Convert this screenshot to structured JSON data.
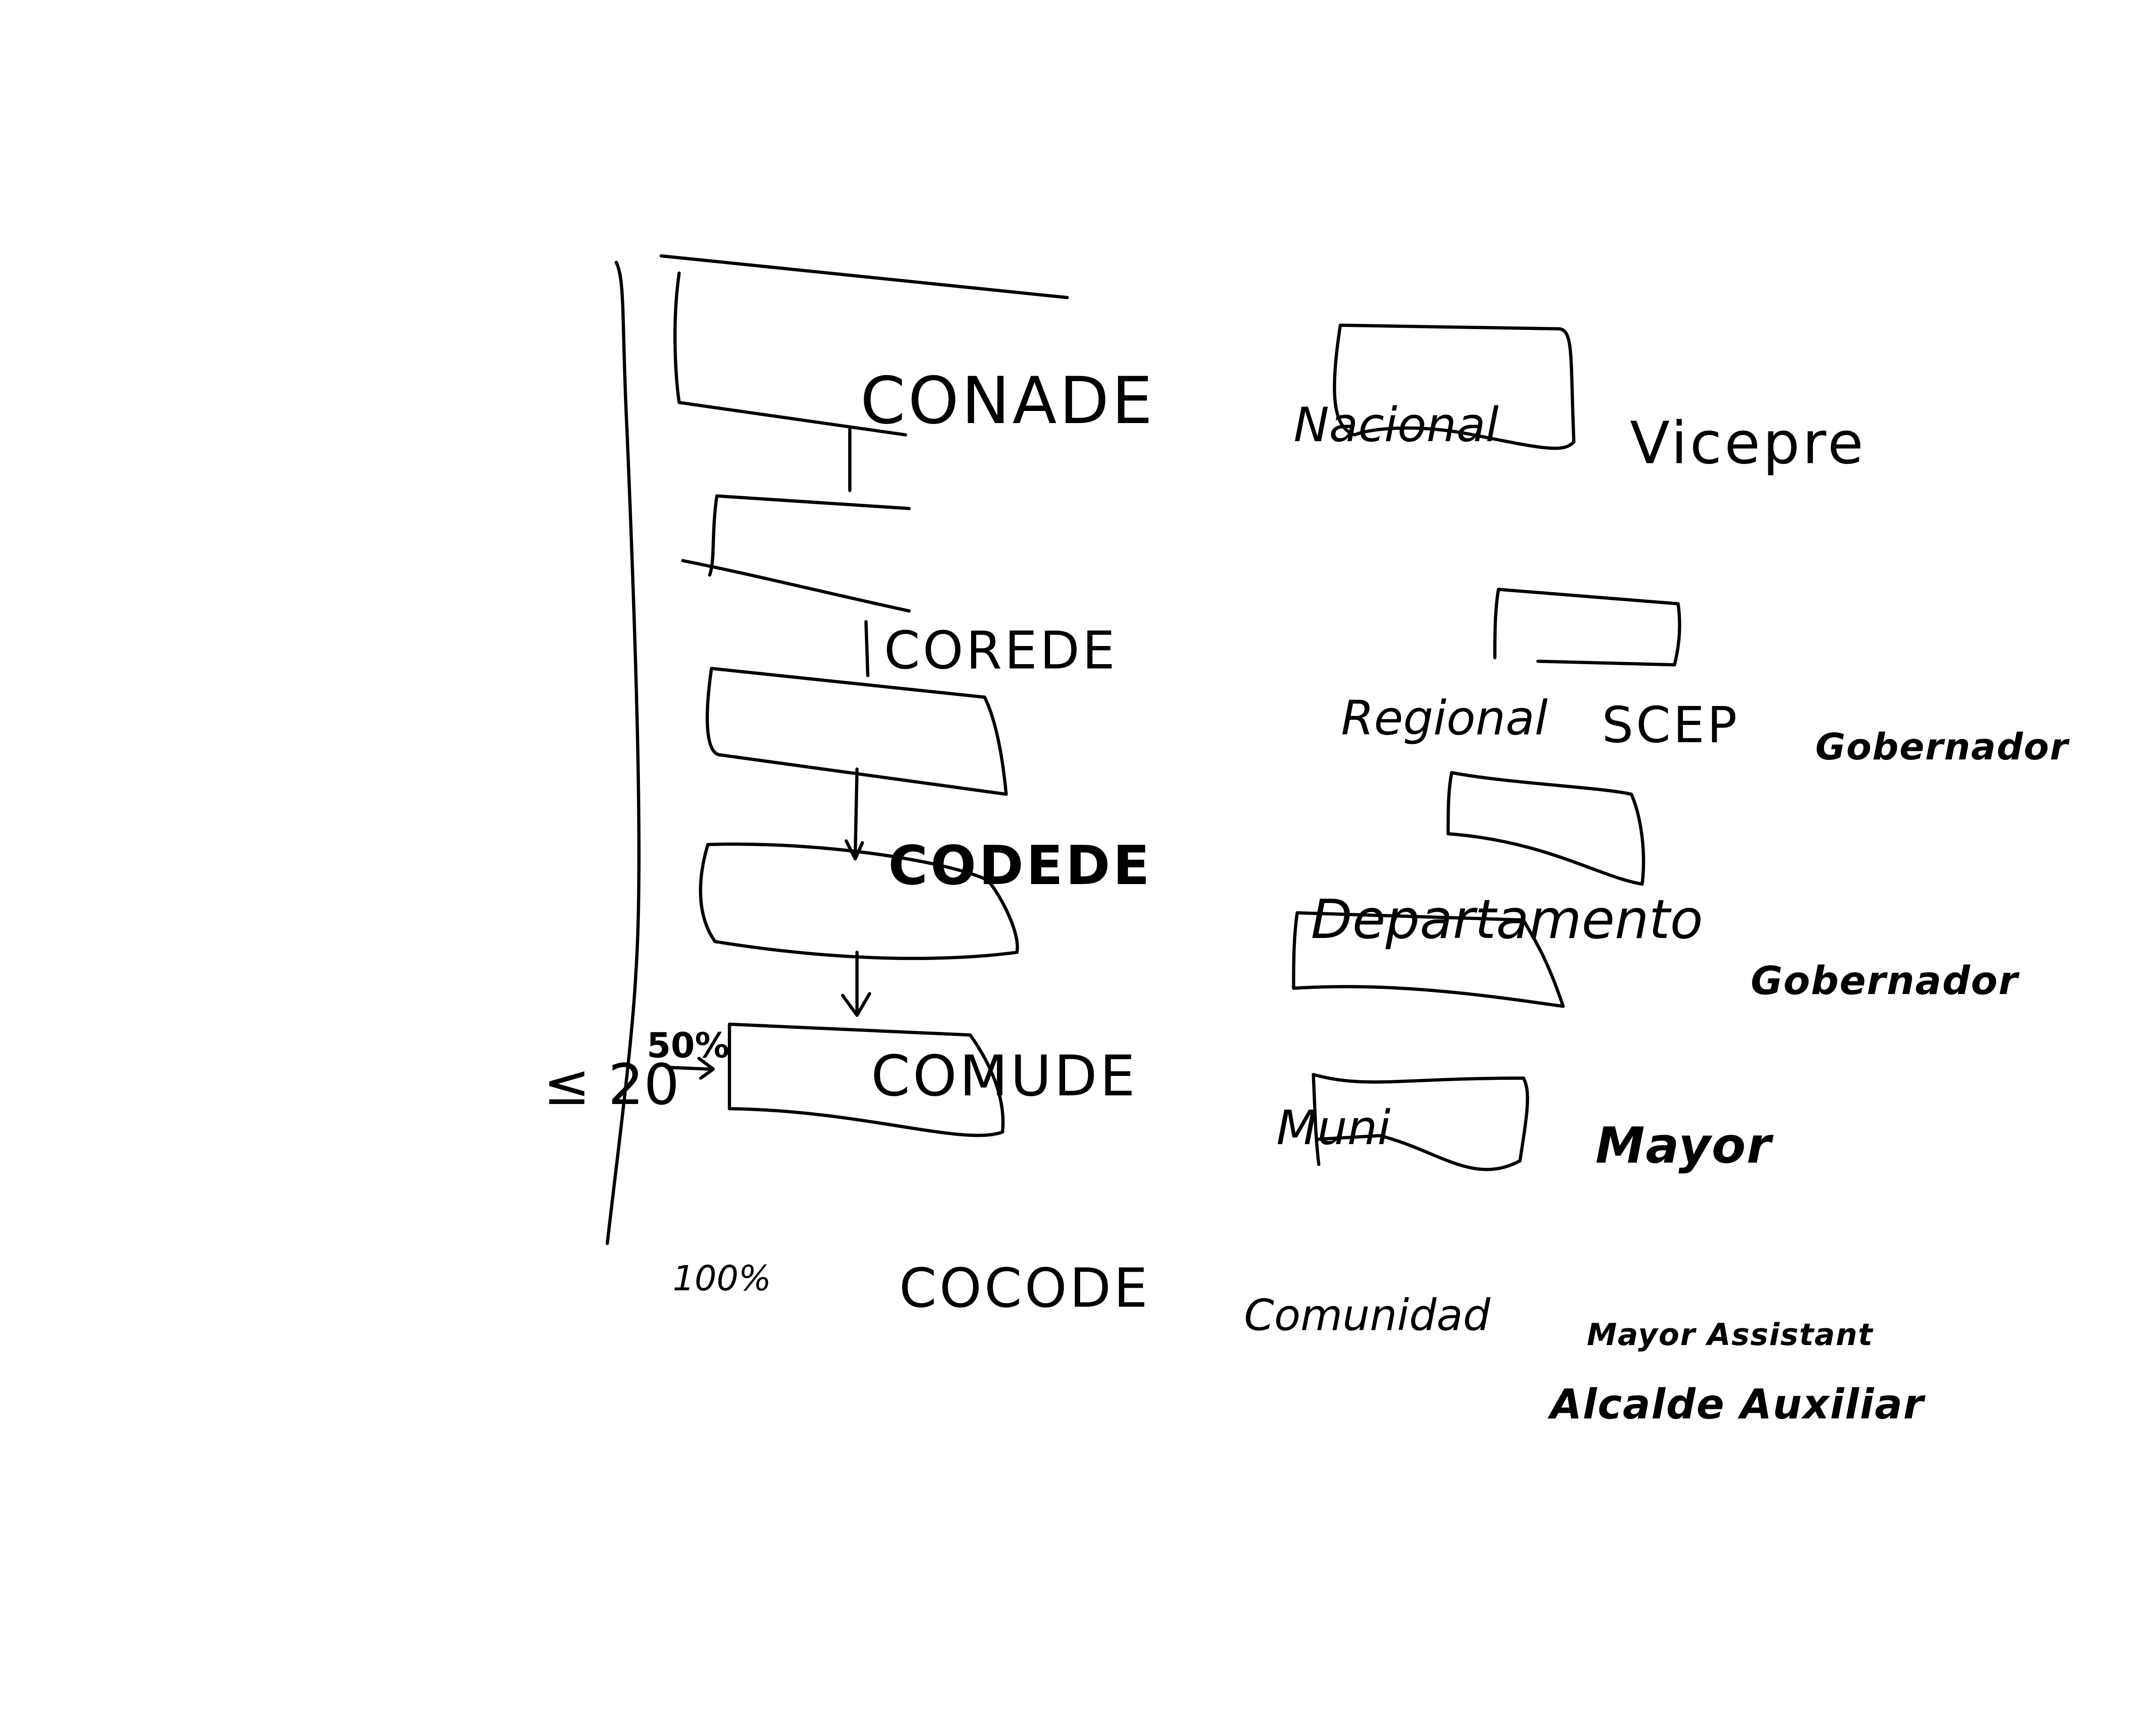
{
  "levels": [
    {
      "council": "CONADE",
      "scope": "Nacional",
      "extra": "",
      "leader": "Vicepre"
    },
    {
      "council": "COREDE",
      "scope": "Regional",
      "extra": "SCEP",
      "leader": "Gobernador"
    },
    {
      "council": "CODEDE",
      "scope": "Departamento",
      "extra": "",
      "leader": "Gobernador"
    },
    {
      "council": "COMUDE",
      "scope": "Muni",
      "extra": "",
      "leader": "Mayor"
    },
    {
      "council": "COCODE",
      "scope": "Comunidad",
      "extra": "",
      "leader": "Mayor Assistant",
      "leader_alt": "Alcalde Auxiliar"
    }
  ],
  "annotations": {
    "limit": "≤ 20",
    "limit_pct": "50%",
    "full_pct": "100%"
  }
}
